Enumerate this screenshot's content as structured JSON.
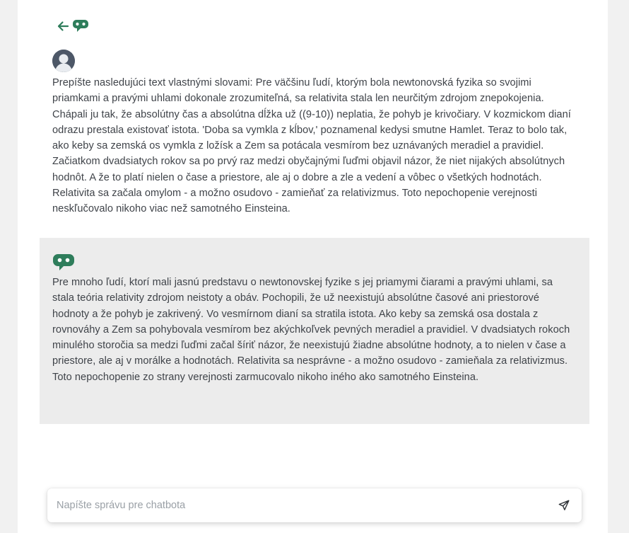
{
  "colors": {
    "accent": "#2e7d5b",
    "user_bubble_bg": "#ffffff",
    "bot_bubble_bg": "#ececec",
    "page_bg": "#f1f1f1",
    "text": "#3f4349"
  },
  "header": {
    "back_icon": "arrow-left-icon",
    "logo_icon": "chat-bubble-icon"
  },
  "messages": {
    "user": {
      "avatar_icon": "user-avatar-icon",
      "text": "Prepíšte nasledujúci text vlastnými slovami: Pre väčšinu ľudí, ktorým bola newtonovská fyzika so svojimi priamkami a pravými uhlami dokonale zrozumiteľná, sa relativita stala len neurčitým zdrojom znepokojenia. Chápali ju tak, že absolútny čas a absolútna dĺžka už ((9-10)) neplatia, že pohyb je krivočiary. V kozmickom dianí odrazu prestala existovať istota. 'Doba sa vymkla z kĺbov,' poznamenal kedysi smutne Hamlet. Teraz to bolo tak, ako keby sa zemská os vymkla z ložísk a Zem sa potácala vesmírom bez uznávaných meradiel a pravidiel. Začiatkom dvadsiatych rokov sa po prvý raz medzi obyčajnými ľuďmi objavil názor, že niet nijakých absolútnych hodnôt. A že to platí nielen o čase a priestore, ale aj o dobre a zle a vedení a vôbec o všetkých hodnotách. Relativita sa začala omylom - a možno osudovo - zamieňať za relativizmus. Toto nepochopenie verejnosti neskľučovalo nikoho viac než samotného Einsteina."
    },
    "bot": {
      "icon": "chat-bubble-icon",
      "text": "Pre mnoho ľudí, ktorí mali jasnú predstavu o newtonovskej fyzike s jej priamymi čiarami a pravými uhlami, sa stala teória relativity zdrojom neistoty a obáv. Pochopili, že už neexistujú absolútne časové ani priestorové hodnoty a že pohyb je zakrivený. Vo vesmírnom dianí sa stratila istota. Ako keby sa zemská osa dostala z rovnováhy a Zem sa pohybovala vesmírom bez akýchkoľvek pevných meradiel a pravidiel. V dvadsiatych rokoch minulého storočia sa medzi ľuďmi začal šíriť názor, že neexistujú žiadne absolútne hodnoty, a to nielen v čase a priestore, ale aj v morálke a hodnotách. Relativita sa nesprávne - a možno osudovo - zamieňala za relativizmus. Toto nepochopenie zo strany verejnosti zarmucovalo nikoho iného ako samotného Einsteina."
    }
  },
  "composer": {
    "placeholder": "Napíšte správu pre chatbota",
    "value": "",
    "send_icon": "send-icon"
  }
}
